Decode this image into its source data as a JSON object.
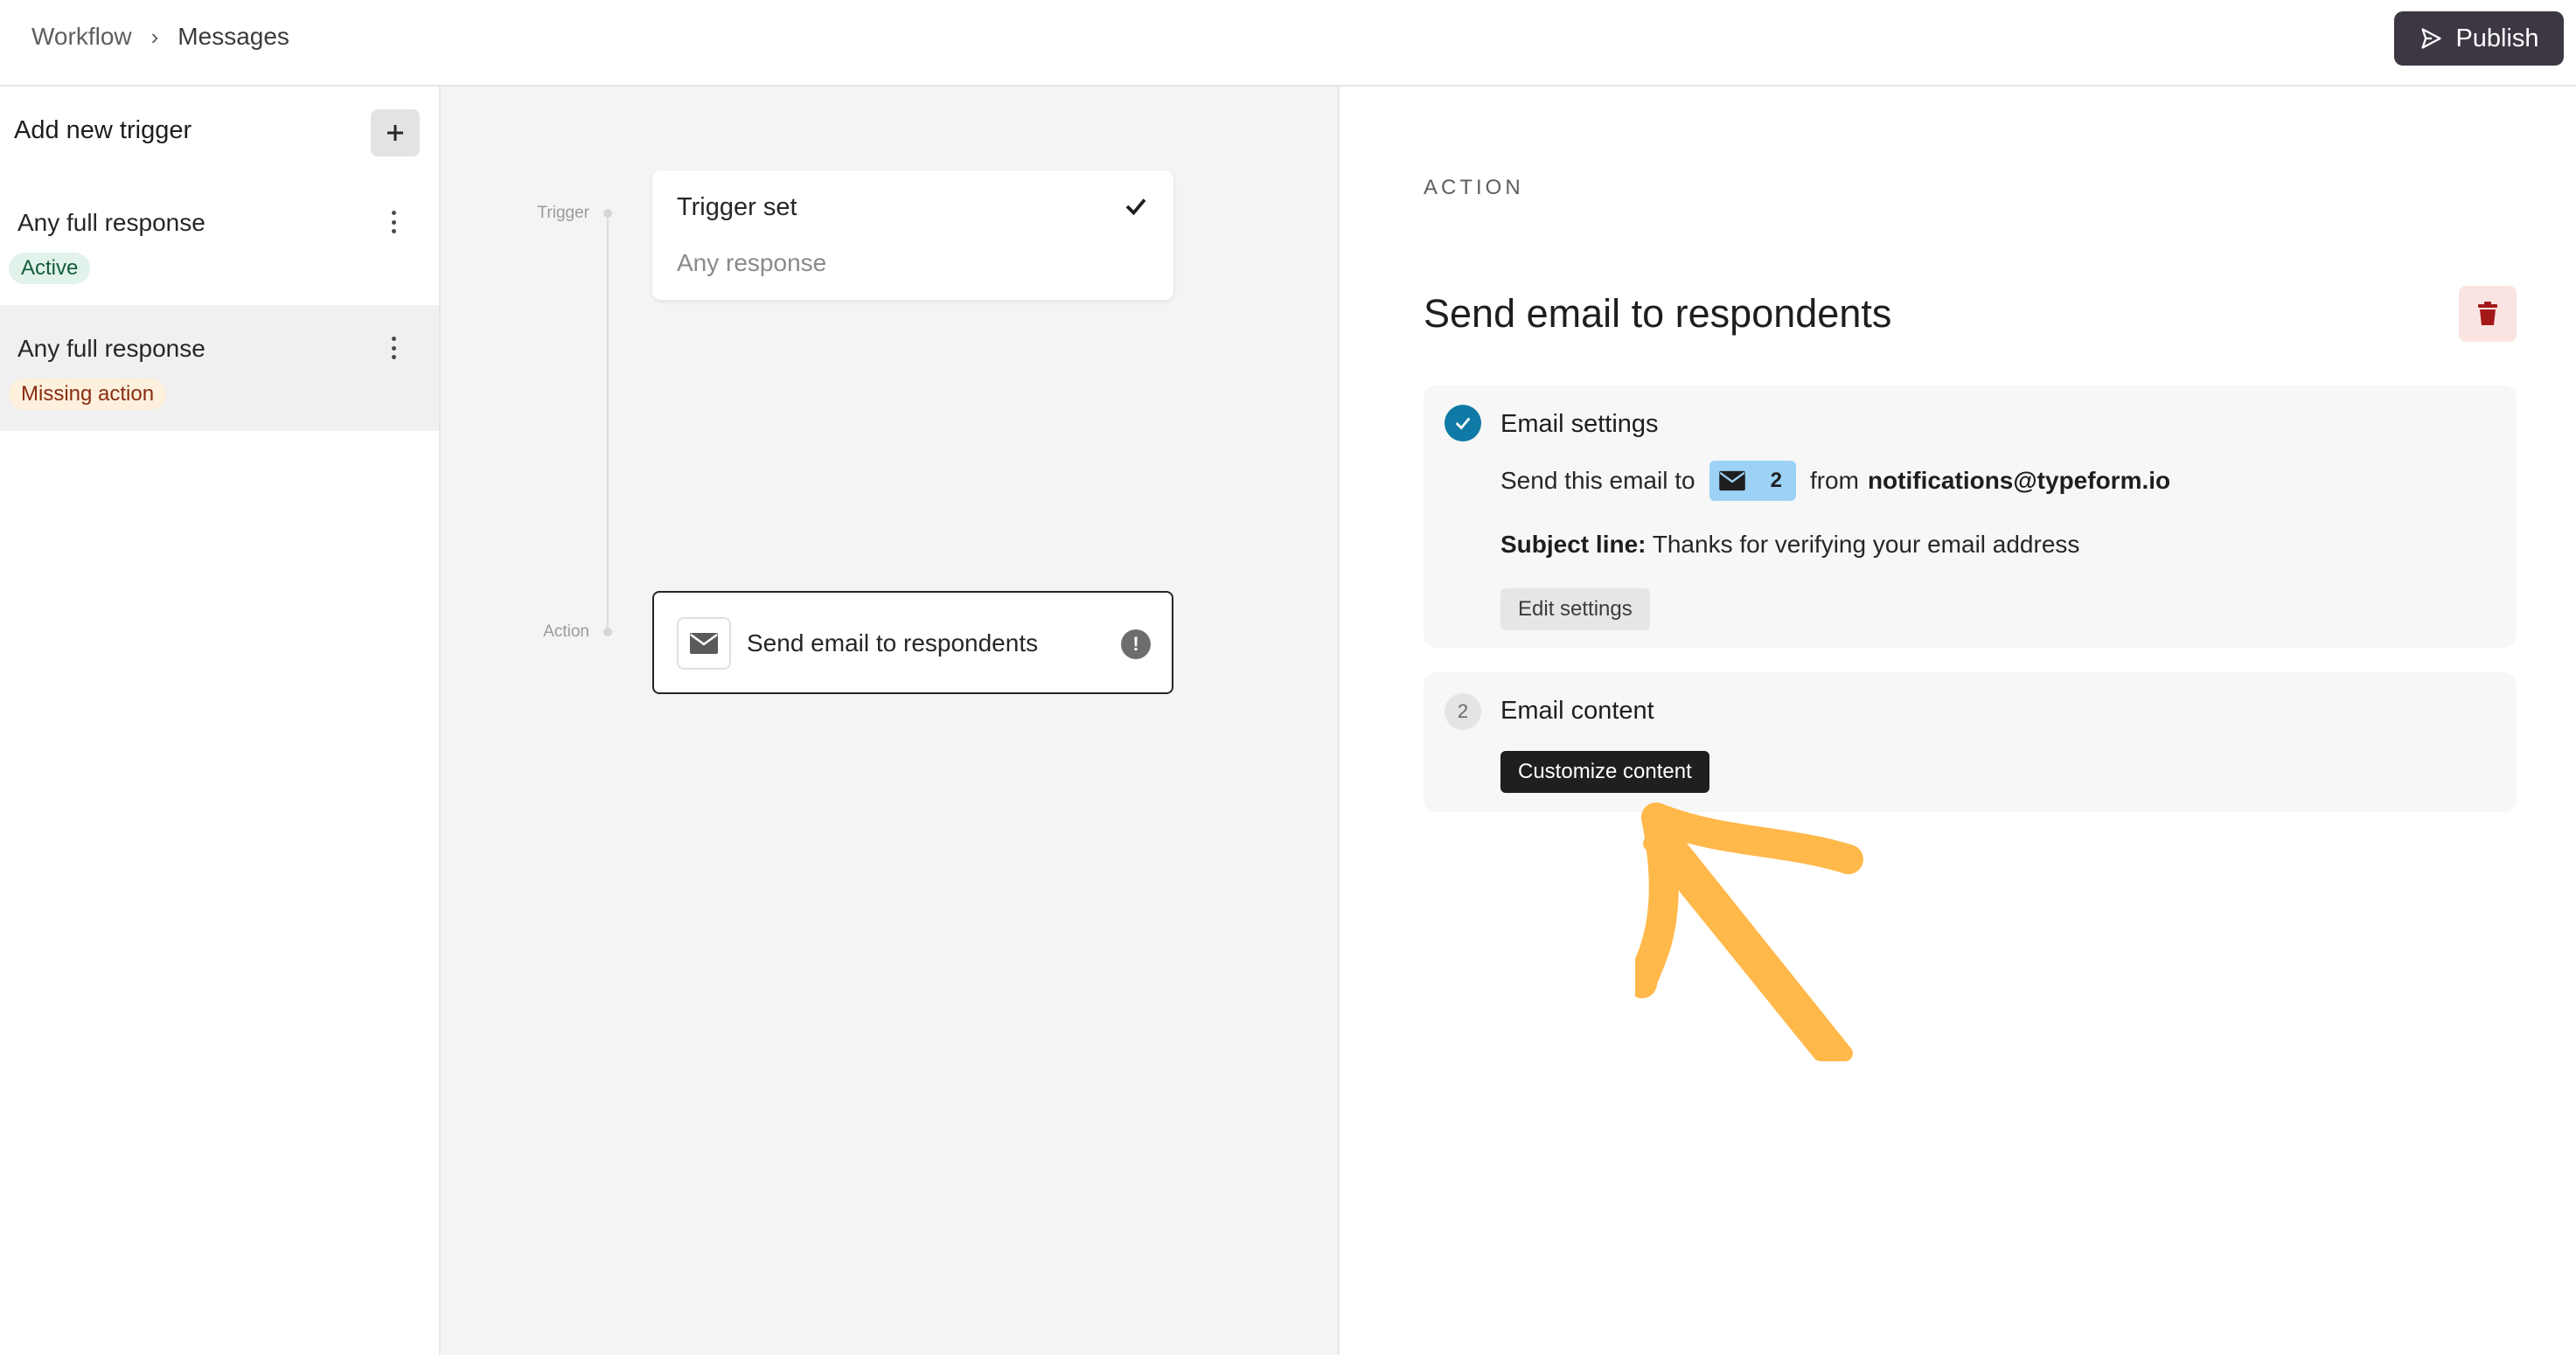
{
  "header": {
    "breadcrumb_root": "Workflow",
    "breadcrumb_sep": "›",
    "breadcrumb_current": "Messages",
    "publish_label": "Publish"
  },
  "sidebar": {
    "heading": "Add new trigger",
    "add_icon": "plus-icon",
    "items": [
      {
        "label": "Any full response",
        "badge": "Active",
        "badge_color": "#e1f3eb"
      },
      {
        "label": "Any full response",
        "badge": "Missing action",
        "badge_color": "#fdf0dc"
      }
    ]
  },
  "canvas": {
    "trigger_node_label": "Trigger",
    "action_node_label": "Action",
    "trigger_card": {
      "title": "Trigger set",
      "subtitle": "Any response"
    },
    "action_card": {
      "label": "Send email to respondents",
      "warning": "!"
    }
  },
  "panel": {
    "caption": "ACTION",
    "title": "Send email to respondents",
    "delete_icon": "trash-icon",
    "steps": [
      {
        "title": "Email settings",
        "send_prefix": "Send this email to",
        "recipient_count": "2",
        "from_prefix": "from",
        "from_address": "notifications@typeform.io",
        "subject_label": "Subject line:",
        "subject_value": "Thanks for verifying your email address",
        "button": "Edit settings"
      },
      {
        "number": "2",
        "title": "Email content",
        "button": "Customize content"
      }
    ]
  },
  "colors": {
    "accent": "#0f7aa5",
    "publish_bg": "#3d3744",
    "arrow": "#ffb84a",
    "recipient_chip": "#9cd2f5"
  }
}
